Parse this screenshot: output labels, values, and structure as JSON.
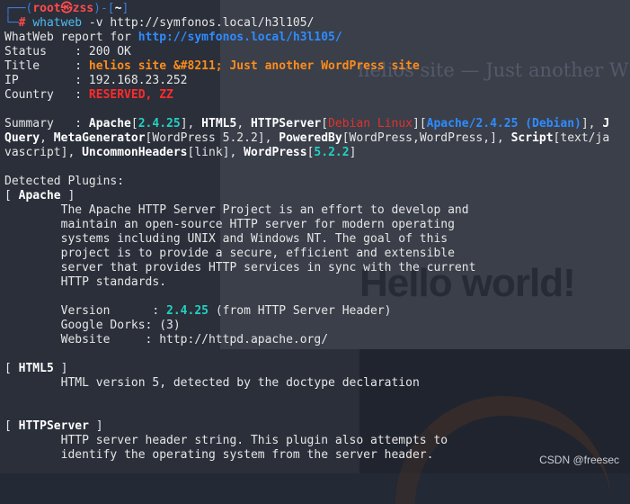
{
  "prompt": {
    "user": "root",
    "host": "zss",
    "dir": "~",
    "symbol": "#",
    "command": "whatweb",
    "args": " -v http://symfonos.local/h3l105/"
  },
  "report": {
    "header_label": "WhatWeb report for ",
    "url": "http://symfonos.local/h3l105/",
    "status_label": "Status    : ",
    "status_value": "200 OK",
    "title_label": "Title     : ",
    "title_value": "helios site &#8211; Just another WordPress site",
    "ip_label": "IP        : ",
    "ip_value": "192.168.23.252",
    "country_label": "Country   : ",
    "country_value": "RESERVED, ZZ"
  },
  "summary": {
    "label": "Summary   : ",
    "apache": "Apache",
    "apache_ver": "2.4.25",
    "html5": "HTML5",
    "httpserver": "HTTPServer",
    "httpserver_os": "Debian Linux",
    "httpserver_str": "Apache/2.4.25 (Debian)",
    "jquery_j": "J",
    "jquery_rest": "Query",
    "metagen": "MetaGenerator",
    "metagen_val": "WordPress 5.2.2",
    "poweredby": "PoweredBy",
    "poweredby_val": "WordPress,WordPress,",
    "script": "Script",
    "script_val_1": "text/ja",
    "script_val_2": "vascript",
    "uncommon": "UncommonHeaders",
    "uncommon_val": "link",
    "wordpress": "WordPress",
    "wordpress_ver": "5.2.2"
  },
  "plugins": {
    "heading": "Detected Plugins:",
    "apache": {
      "name": "Apache",
      "desc": [
        "The Apache HTTP Server Project is an effort to develop and",
        "maintain an open-source HTTP server for modern operating",
        "systems including UNIX and Windows NT. The goal of this",
        "project is to provide a secure, efficient and extensible",
        "server that provides HTTP services in sync with the current",
        "HTTP standards."
      ],
      "version_label": "Version      : ",
      "version_value": "2.4.25",
      "version_note": " (from HTTP Server Header)",
      "dorks": "Google Dorks: (3)",
      "website": "Website     : http://httpd.apache.org/"
    },
    "html5": {
      "name": "HTML5",
      "desc": "HTML version 5, detected by the doctype declaration"
    },
    "httpserver": {
      "name": "HTTPServer",
      "desc": [
        "HTTP server header string. This plugin also attempts to",
        "identify the operating system from the server header."
      ]
    }
  },
  "background": {
    "site_title": "helios site — Just another W",
    "hello": "Hello world!"
  },
  "watermark": "CSDN @freesec"
}
